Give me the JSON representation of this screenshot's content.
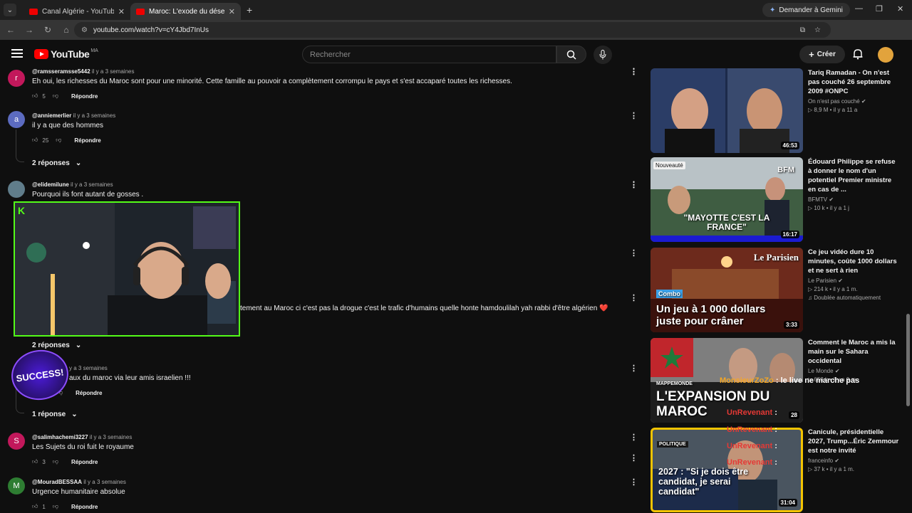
{
  "browser": {
    "tabs": [
      {
        "title": "Canal Algérie - YouTube",
        "active": false
      },
      {
        "title": "Maroc: L'exode du désespoir ve",
        "active": true
      }
    ],
    "gemini_label": "Demander à Gemini",
    "url": "youtube.com/watch?v=cY4Jbd7InUs"
  },
  "youtube": {
    "logo_text": "YouTube",
    "country_code": "MA",
    "search_placeholder": "Rechercher",
    "create_label": "Créer"
  },
  "comments": [
    {
      "handle": "@ramsseramsse5442",
      "time": "il y a 3 semaines",
      "text": "Eh oui, les richesses du Maroc sont pour une minorité. Cette famille au pouvoir a complètement corrompu le pays et s'est accaparé toutes les richesses.",
      "likes": "5",
      "reply": "Répondre",
      "avatar": "r",
      "avatar_color": "#c2185b"
    },
    {
      "handle": "@anniemerlier",
      "time": "il y a 3 semaines",
      "text": "il y a que des hommes",
      "likes": "25",
      "reply": "Répondre",
      "avatar": "a",
      "avatar_color": "#5c6bc0",
      "replies": "2 réponses"
    },
    {
      "handle": "@elidemilune",
      "time": "il y a 3 semaines",
      "text": "Pourquoi ils font autant de gosses .",
      "avatar_color": "#607d8b"
    },
    {
      "text_partial": "tement au Maroc ci c'est pas la drogue c'est le trafic d'humains quelle honte hamdoulilah yah rabbi d'être algérien ❤️",
      "replies": "2 réponses"
    },
    {
      "time": "y a 3 semaines",
      "text": "aux du maroc via leur amis israelien !!!",
      "reply": "Répondre",
      "replies": "1 réponse"
    },
    {
      "handle": "@salimhachemi3227",
      "time": "il y a 3 semaines",
      "text": "Les Sujets du roi fuit le royaume",
      "likes": "3",
      "reply": "Répondre",
      "avatar": "S",
      "avatar_color": "#c2185b"
    },
    {
      "handle": "@MouradBESSAA",
      "time": "il y a 3 semaines",
      "text": "Urgence humanitaire absolue",
      "likes": "1",
      "reply": "Répondre",
      "avatar": "M",
      "avatar_color": "#2e7d32"
    }
  ],
  "overlay": {
    "kick_logo": "K",
    "sticker_text": "SUCCESS!"
  },
  "sidebar": [
    {
      "title": "Tariq Ramadan - On n'est pas couché 26 septembre 2009 #ONPC",
      "channel": "On n'est pas couché",
      "views": "8,9 M",
      "age": "il y a 11 a",
      "duration": "46:53"
    },
    {
      "title": "Édouard Philippe se refuse à donner le nom d'un potentiel Premier ministre en cas de ...",
      "channel": "BFMTV",
      "views": "10 k",
      "age": "il y a 1 j",
      "duration": "16:17",
      "badge": "Nouveauté",
      "thumb_caption": "\"MAYOTTE C'EST LA FRANCE\"",
      "thumb_logo": "BFM"
    },
    {
      "title": "Ce jeu vidéo dure 10 minutes, coûte 1000 dollars et ne sert à rien",
      "channel": "Le Parisien",
      "views": "214 k",
      "age": "il y a 1 m.",
      "extra": "Doublée automatiquement",
      "duration": "3:33",
      "thumb_tag": "Combo",
      "thumb_caption": "Un jeu à 1 000 dollars juste pour crâner",
      "thumb_logo": "Le Parisien"
    },
    {
      "title": "Comment le Maroc a mis la main sur le Sahara occidental",
      "channel": "Le Monde",
      "views": "653 k",
      "age": "il y a 9 m.",
      "duration": "28",
      "thumb_tag": "MAPPEMONDE",
      "thumb_caption": "L'EXPANSION DU MAROC"
    },
    {
      "title": "Canicule, présidentielle 2027, Trump...Éric Zemmour est notre invité",
      "channel": "franceinfo",
      "views": "37 k",
      "age": "il y a 1 m.",
      "duration": "31:04",
      "thumb_tag": "POLITIQUE",
      "thumb_caption": "2027 : \"Si je dois être candidat, je serai candidat\""
    }
  ],
  "chat_overlay": [
    {
      "user": "MonsieurZoZo",
      "text": ": le live ne marche pas"
    },
    {
      "user": "UnRevenant",
      "text": ":"
    },
    {
      "user": "UnRevenant",
      "text": ":"
    },
    {
      "user": "UnRevenant",
      "text": ":"
    },
    {
      "user": "UnRevenant",
      "text": ":"
    }
  ],
  "colors": {
    "accent": "#ff0000",
    "kick_green": "#53fc18"
  }
}
